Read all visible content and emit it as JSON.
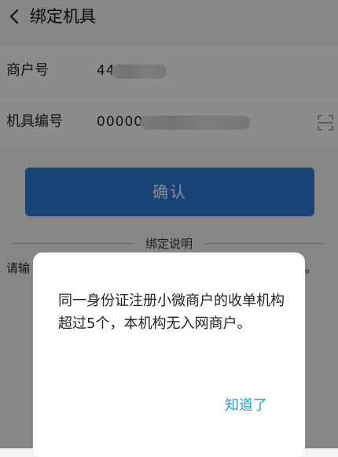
{
  "header": {
    "title": "绑定机具"
  },
  "form": {
    "merchant_label": "商户号",
    "merchant_value": "44",
    "device_label": "机具编号",
    "device_value": "00000"
  },
  "confirm_button": "确认",
  "instructions": {
    "section_title": "绑定说明",
    "text_visible": "请输",
    "text_tail": "。"
  },
  "dialog": {
    "message": "同一身份证注册小微商户的收单机构超过5个，本机构无入网商户。",
    "ok_button": "知道了"
  },
  "colors": {
    "primary": "#2a7bd8",
    "dialog_button": "#2aa0c8"
  }
}
